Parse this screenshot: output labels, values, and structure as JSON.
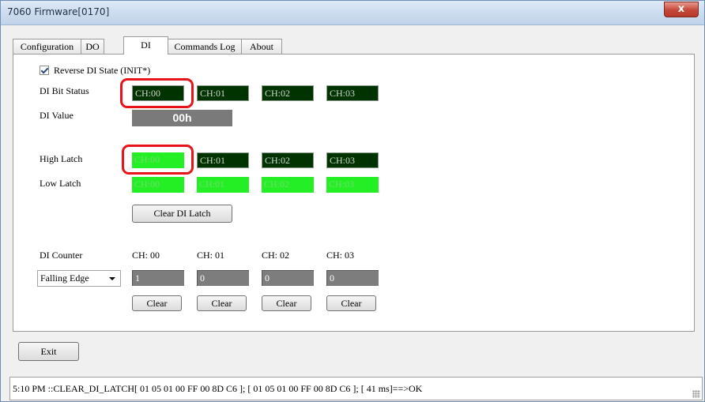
{
  "window": {
    "title": "7060 Firmware[0170]",
    "close_label": "x"
  },
  "tabs": [
    {
      "label": "Configuration",
      "active": false
    },
    {
      "label": "DO",
      "active": false
    },
    {
      "label": "DI",
      "active": true
    },
    {
      "label": "Commands Log",
      "active": false
    },
    {
      "label": "About",
      "active": false
    }
  ],
  "di": {
    "reverse_state": {
      "label": "Reverse DI State  (INIT*)",
      "checked": true
    },
    "bit_status": {
      "label": "DI Bit Status",
      "channels": [
        "CH:00",
        "CH:01",
        "CH:02",
        "CH:03"
      ]
    },
    "value": {
      "label": "DI Value",
      "text": "00h"
    },
    "high_latch": {
      "label": "High Latch",
      "channels": [
        "CH:00",
        "CH:01",
        "CH:02",
        "CH:03"
      ]
    },
    "low_latch": {
      "label": "Low Latch",
      "channels": [
        "CH:00",
        "CH:01",
        "CH:02",
        "CH:03"
      ]
    },
    "clear_latch_label": "Clear DI Latch",
    "counter": {
      "label": "DI Counter",
      "channel_labels": [
        "CH: 00",
        "CH: 01",
        "CH: 02",
        "CH: 03"
      ],
      "values": [
        "1",
        "0",
        "0",
        "0"
      ],
      "clear_label": "Clear",
      "edge_selected": "Falling Edge"
    }
  },
  "exit_label": "Exit",
  "status": "5:10 PM ::CLEAR_DI_LATCH[ 01 05 01 00 FF 00 8D C6 ]; [ 01 05 01 00 FF 00 8D C6  ]; [ 41 ms]==>OK",
  "colors": {
    "led_dark": "#003300",
    "led_bright": "#24ef24",
    "highlight": "#e8121a"
  }
}
